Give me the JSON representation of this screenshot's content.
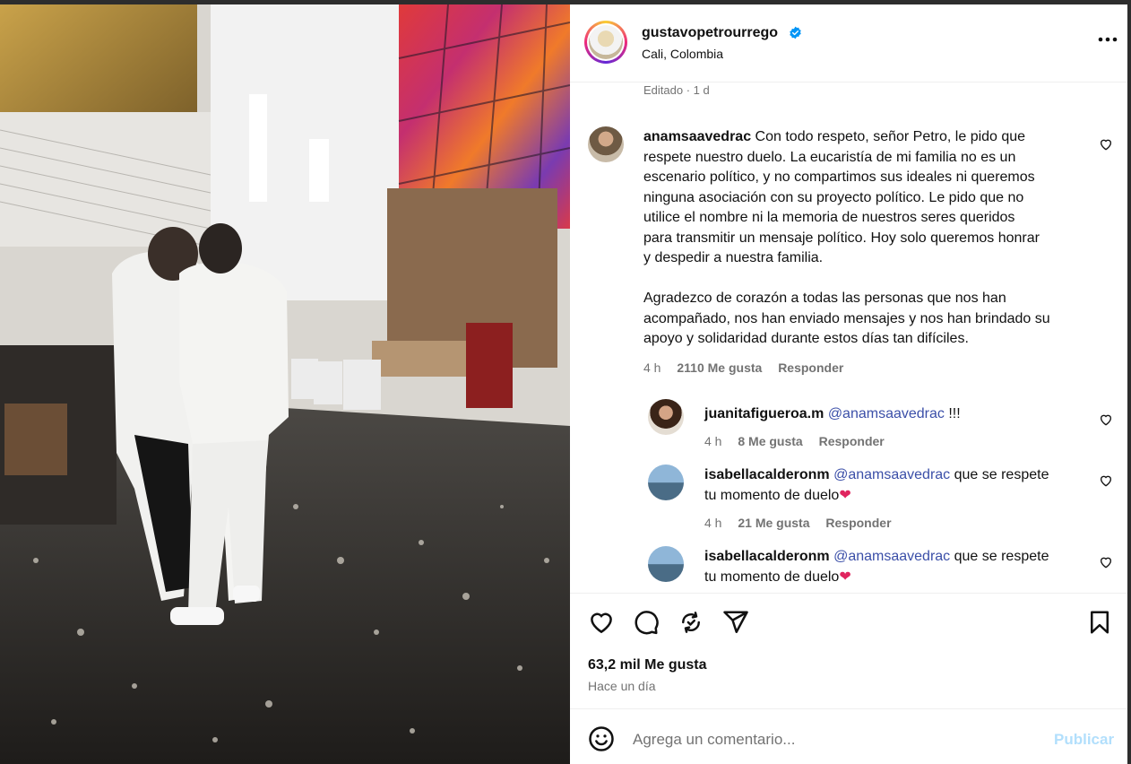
{
  "post": {
    "username": "gustavopetrourrego",
    "location": "Cali, Colombia",
    "edited_label": "Editado · 1 d"
  },
  "main_comment": {
    "username": "anamsaavedrac",
    "text_line1": "Con todo respeto, señor Petro, le pido que",
    "text_lines": [
      "respete nuestro duelo. La eucaristía de mi familia no es un",
      "escenario político, y no compartimos sus ideales ni queremos",
      "ninguna asociación con su proyecto político. Le pido que no",
      "utilice el nombre ni la memoria de nuestros seres queridos",
      "para transmitir un mensaje político. Hoy solo queremos honrar",
      "y despedir a nuestra familia."
    ],
    "para2_lines": [
      "Agradezco de corazón a todas las personas que nos han",
      "acompañado, nos han enviado mensajes y nos han brindado su",
      "apoyo y solidaridad durante estos días tan difíciles."
    ],
    "time": "4 h",
    "likes": "2110 Me gusta",
    "reply": "Responder"
  },
  "replies": [
    {
      "username": "juanitafigueroa.m",
      "mention": "@anamsaavedrac",
      "text": " !!!",
      "line2": "",
      "time": "4 h",
      "likes": "8 Me gusta",
      "reply": "Responder"
    },
    {
      "username": "isabellacalderonm",
      "mention": "@anamsaavedrac",
      "text": " que se respete",
      "line2": "tu momento de duelo",
      "time": "4 h",
      "likes": "21 Me gusta",
      "reply": "Responder"
    },
    {
      "username": "isabellacalderonm",
      "mention": "@anamsaavedrac",
      "text": " que se respete",
      "line2": "tu momento de duelo",
      "time": "",
      "likes": "",
      "reply": ""
    }
  ],
  "footer": {
    "likes_total": "63,2 mil Me gusta",
    "time_ago": "Hace un día",
    "comment_placeholder": "Agrega un comentario...",
    "publish_label": "Publicar"
  },
  "icons": {
    "verified": "verified-badge-icon",
    "more": "more-options-icon",
    "like": "heart-icon",
    "comment": "comment-icon",
    "share": "repost-icon",
    "send": "send-icon",
    "save": "bookmark-icon",
    "emoji": "emoji-icon"
  },
  "colors": {
    "link": "#3b4fa8",
    "publish_disabled": "#b2dffc",
    "verified": "#0095f6",
    "heart_emoji": "#e0245e"
  }
}
